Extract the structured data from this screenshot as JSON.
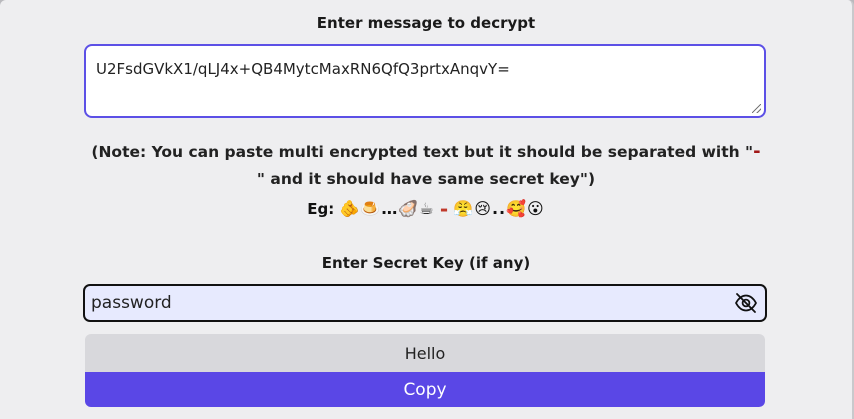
{
  "decrypt": {
    "label": "Enter message to decrypt",
    "message_value": "U2FsdGVkX1/qLJ4x+QB4MytcMaxRN6QfQ3prtxAnqvY="
  },
  "note": {
    "part1": "(Note: You can paste multi encrypted text but it should be separated with \"",
    "separator": "-",
    "part2": "\" and it should have same secret key\")"
  },
  "example": {
    "prefix": "Eg:",
    "group1": "🫵🍮…🦪☕",
    "dash": "-",
    "group2": "😤😢..🥰😮"
  },
  "secret": {
    "label": "Enter Secret Key (if any)",
    "value": "password",
    "toggle_icon": "eye-off-icon"
  },
  "output": {
    "result_text": "Hello",
    "copy_label": "Copy"
  },
  "colors": {
    "accent": "#5a47e6",
    "input_bg": "#e7eafe",
    "separator_red": "#a11717"
  }
}
